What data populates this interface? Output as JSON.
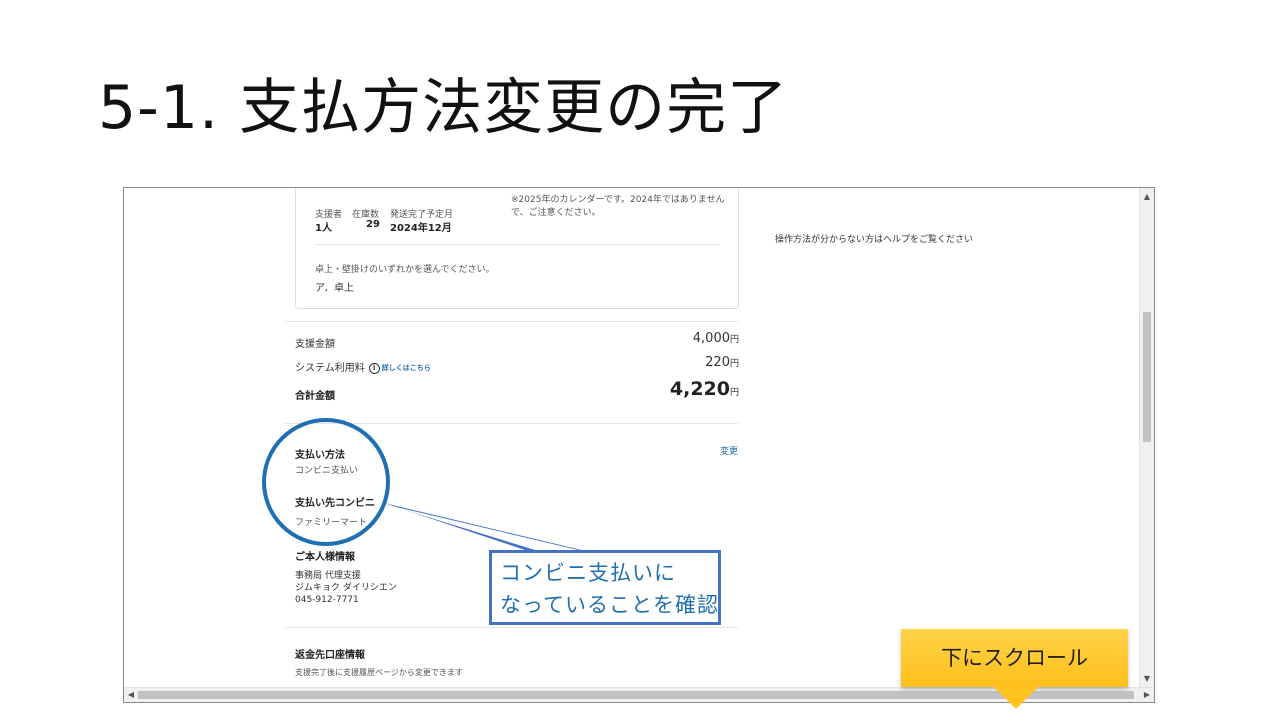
{
  "slide": {
    "title": "5-1. 支払方法変更の完了"
  },
  "card": {
    "supporters_label": "支援者",
    "supporters_value": "1人",
    "stock_label": "在庫数",
    "stock_value": "29",
    "ship_label": "発送完了予定月",
    "ship_value": "2024年12月",
    "note_line1": "※2025年のカレンダーです。2024年ではありません",
    "note_line2": "で、ご注意ください。",
    "question": "卓上・壁掛けのいずれかを選んでください。",
    "answer": "ア．卓上"
  },
  "help": {
    "text": "操作方法が分からない方はヘルプをご覧ください"
  },
  "amounts": {
    "support_label": "支援金額",
    "support_value": "4,000",
    "system_label": "システム利用料",
    "system_link": "詳しくはこちら",
    "system_value": "220",
    "total_label": "合計金額",
    "total_value": "4,220",
    "yen": "円"
  },
  "payment": {
    "method_title": "支払い方法",
    "method_value": "コンビニ支払い",
    "store_title": "支払い先コンビニ",
    "store_value": "ファミリーマート",
    "change_link": "変更"
  },
  "personal": {
    "title": "ご本人様情報",
    "line1": "事務局 代理支援",
    "line2": "ジムキョク ダイリシエン",
    "line3": "045-912-7771"
  },
  "refund": {
    "title": "返金先口座情報",
    "text": "支援完了後に支援履歴ページから変更できます"
  },
  "annotations": {
    "callout": "コンビニ支払いに\nなっていることを確認",
    "scroll_note": "下にスクロール"
  }
}
